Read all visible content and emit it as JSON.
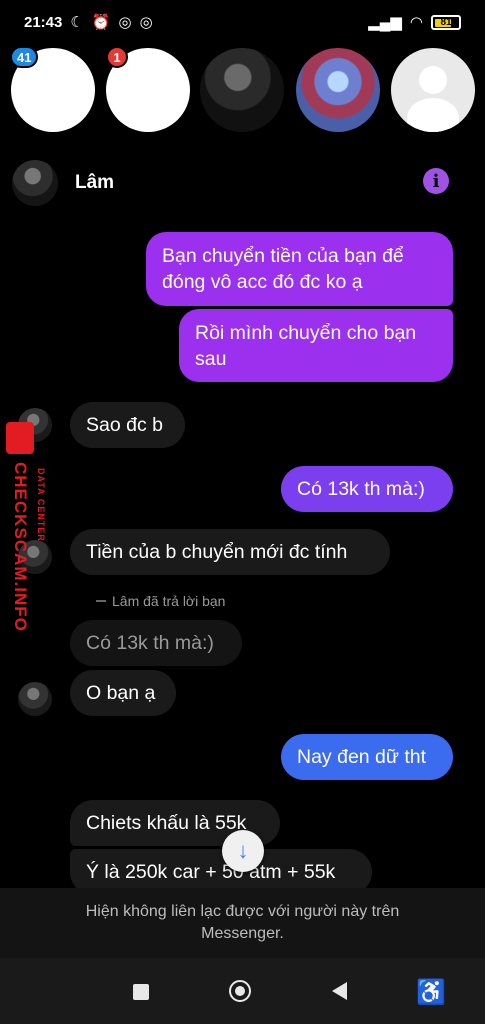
{
  "status_bar": {
    "time": "21:43",
    "left_icons": [
      "moon-icon",
      "alarm-icon",
      "messenger-icon",
      "messenger-icon"
    ],
    "right_icons": [
      "signal-icon",
      "wifi-icon",
      "battery-icon"
    ],
    "battery_level": "81"
  },
  "chat_heads": {
    "badges": [
      "41",
      "1"
    ]
  },
  "conversation": {
    "contact_name": "Lâm",
    "messages": [
      {
        "dir": "out",
        "text": "Bạn chuyển tiền của bạn để\nđóng vô acc đó đc ko ạ"
      },
      {
        "dir": "out",
        "text": "Rồi mình chuyển cho bạn\nsau"
      },
      {
        "dir": "in",
        "text": "Sao đc b"
      },
      {
        "dir": "out",
        "text": "Có 13k th mà:)"
      },
      {
        "dir": "in",
        "text": "Tiền của b chuyển mới đc tính"
      },
      {
        "dir": "in",
        "text": "Có 13k th mà:)",
        "kind": "quoted"
      },
      {
        "dir": "in",
        "text": "O bạn ạ"
      },
      {
        "dir": "out",
        "text": "Nay đen dữ tht"
      },
      {
        "dir": "in",
        "text": "Chiets khấu là 55k"
      },
      {
        "dir": "in",
        "text": "Ý là 250k car + 50 atm + 55k"
      }
    ],
    "reply_note": "Lâm đã trả lời bạn",
    "unavailable_notice": "Hiện không liên lạc được với người này trên Messenger."
  },
  "watermark": {
    "main": "CHECKSCAM.INFO",
    "sub": "DATA CENTER"
  },
  "colors": {
    "outgoing_purple": "#9b30ef",
    "outgoing_blue": "#3b6cf0",
    "incoming_bubble": "#1a1a1a",
    "info_icon": "#a051e6"
  }
}
